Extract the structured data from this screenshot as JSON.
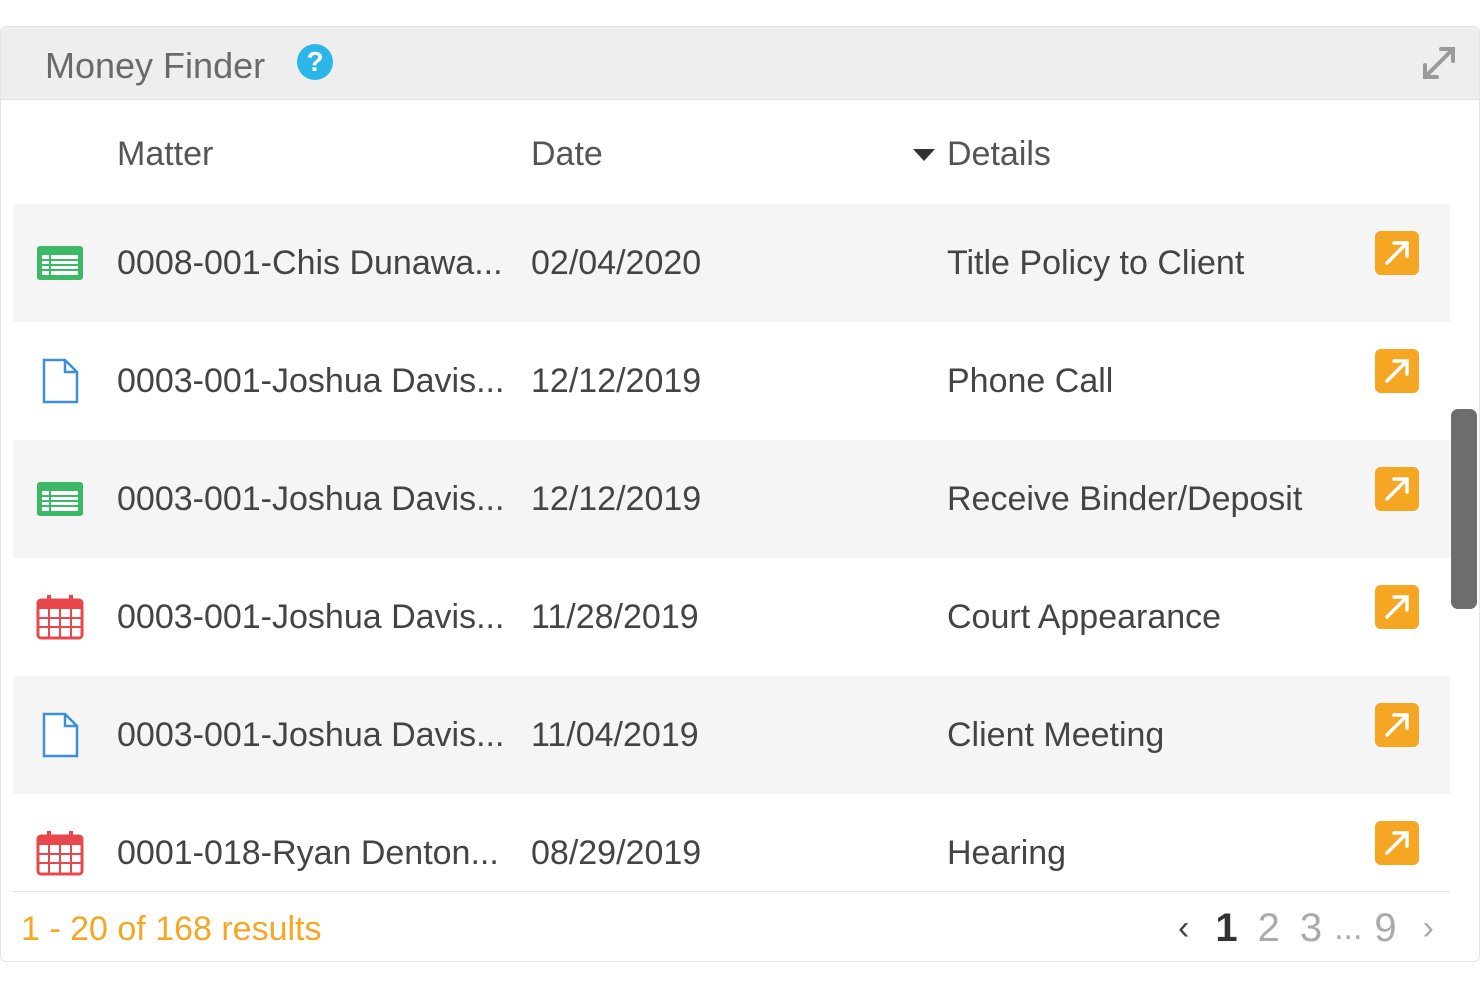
{
  "widget": {
    "title": "Money Finder",
    "help_glyph": "?",
    "expand_icon": "expand-arrows-icon"
  },
  "columns": {
    "matter": "Matter",
    "date": "Date",
    "details": "Details",
    "sort_indicator": "caret-down-icon"
  },
  "rows": [
    {
      "icon": "spreadsheet-icon",
      "matter": "0008-001-Chis Dunawa...",
      "date": "02/04/2020",
      "details": "Title Policy to Client"
    },
    {
      "icon": "document-icon",
      "matter": "0003-001-Joshua Davis...",
      "date": "12/12/2019",
      "details": "Phone Call"
    },
    {
      "icon": "spreadsheet-icon",
      "matter": "0003-001-Joshua Davis...",
      "date": "12/12/2019",
      "details": "Receive Binder/Deposit"
    },
    {
      "icon": "calendar-icon",
      "matter": "0003-001-Joshua Davis...",
      "date": "11/28/2019",
      "details": "Court Appearance"
    },
    {
      "icon": "document-icon",
      "matter": "0003-001-Joshua Davis...",
      "date": "11/04/2019",
      "details": "Client Meeting"
    },
    {
      "icon": "calendar-icon",
      "matter": "0001-018-Ryan Denton...",
      "date": "08/29/2019",
      "details": "Hearing"
    }
  ],
  "footer": {
    "results_text": "1 - 20 of 168 results",
    "pages": {
      "prev": "‹",
      "p1": "1",
      "p2": "2",
      "p3": "3",
      "ellipsis": "...",
      "last": "9",
      "next": "›"
    }
  },
  "colors": {
    "accent": "#f5a623",
    "help": "#2cb5e8",
    "spreadsheet": "#3cb964",
    "document": "#3d8fd9",
    "calendar": "#e8474c"
  }
}
